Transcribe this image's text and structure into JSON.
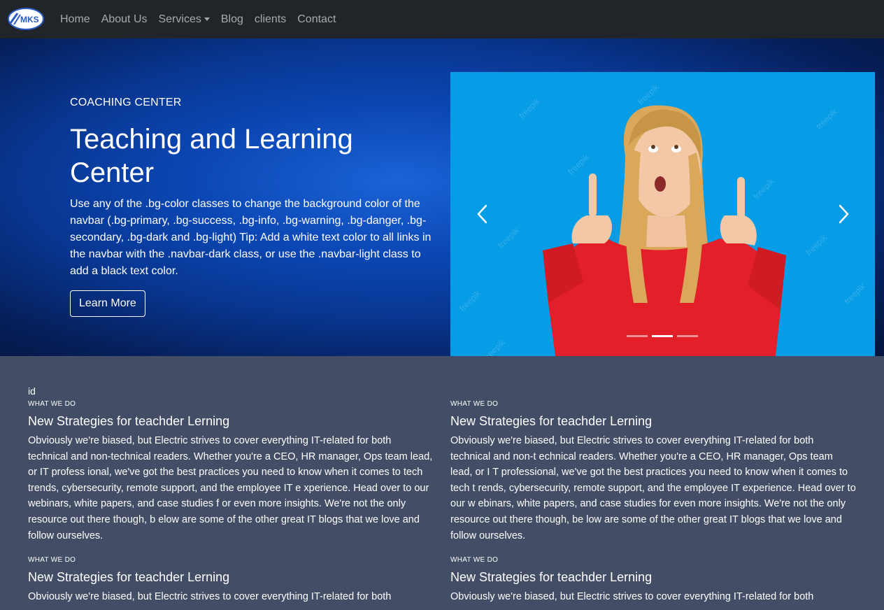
{
  "navbar": {
    "brand_text": "MKS",
    "links": [
      "Home",
      "About Us",
      "Services",
      "Blog",
      "clients",
      "Contact"
    ]
  },
  "hero": {
    "eyebrow": "COACHING CENTER",
    "title": "Teaching and Learning Center",
    "body": "Use any of the .bg-color classes to change the background color of the navbar (.bg-primary, .bg-success, .bg-info, .bg-warning, .bg-danger, .bg-secondary, .bg-dark and .bg-light) Tip: Add a white text color to all links in the navbar with the .navbar-dark class, or use the .navbar-light class to add a black text color.",
    "button": "Learn More"
  },
  "carousel": {
    "watermark": "freepik",
    "active_index": 1,
    "slide_count": 3
  },
  "section": {
    "id_label": "id",
    "cards": [
      {
        "kicker": "WHAT WE DO",
        "title": "New Strategies for teachder Lerning",
        "body": "Obviously we're biased, but Electric strives to cover everything IT-related for both technical and non-technical readers. Whether you're a CEO, HR manager, Ops team lead, or IT profess ional, we've got the best practices you need to know when it comes to tech trends, cybersecurity, remote support, and the employee IT e xperience. Head over to our webinars, white papers, and case studies f or even more insights. We're not the only resource out there though, b elow are some of the other great IT blogs that we love and follow ourselves."
      },
      {
        "kicker": "WHAT WE DO",
        "title": "New Strategies for teachder Lerning",
        "body": "Obviously we're biased, but Electric strives to cover everything IT-related for both technical and non-t echnical readers. Whether you're a CEO, HR manager, Ops team lead, or I T professional, we've got the best practices you need to know when it comes to tech t rends, cybersecurity, remote support, and the employee IT experience. Head over to our w ebinars, white papers, and case studies for even more insights. We're not the only resource out there though, be low are some of the other great IT blogs that we love and follow ourselves."
      },
      {
        "kicker": "WHAT WE DO",
        "title": "New Strategies for teachder Lerning",
        "body": "Obviously we're biased, but Electric strives to cover everything IT-related for both"
      },
      {
        "kicker": "WHAT WE DO",
        "title": "New Strategies for teachder Lerning",
        "body": "Obviously we're biased, but Electric strives to cover everything IT-related for both"
      }
    ]
  },
  "colors": {
    "navbar_bg": "#212529",
    "section_bg": "#434e66",
    "carousel_bg": "#069de6",
    "hoodie": "#e3202a"
  }
}
